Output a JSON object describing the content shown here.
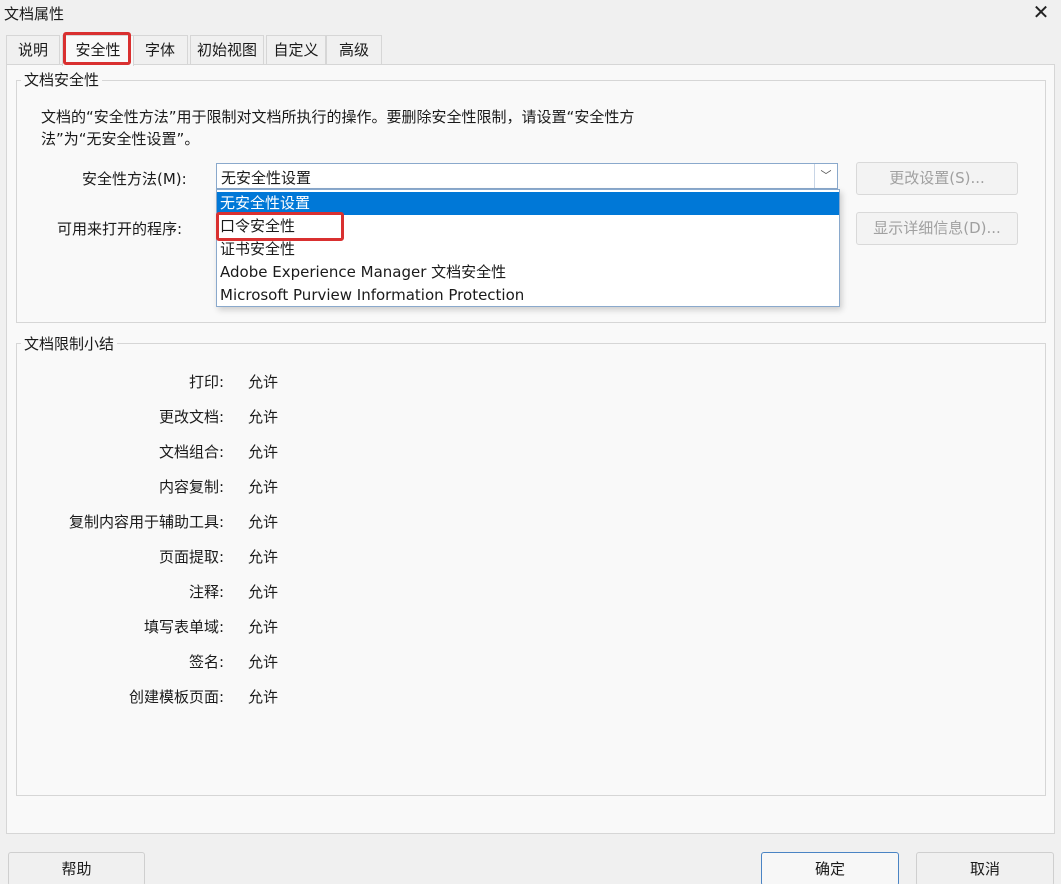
{
  "window": {
    "title": "文档属性",
    "close_icon": "close-icon"
  },
  "tabs": [
    {
      "label": "说明"
    },
    {
      "label": "安全性",
      "active": true
    },
    {
      "label": "字体"
    },
    {
      "label": "初始视图"
    },
    {
      "label": "自定义"
    },
    {
      "label": "高级"
    }
  ],
  "security": {
    "group_title": "文档安全性",
    "description_line1": "文档的“安全性方法”用于限制对文档所执行的操作。要删除安全性限制，请设置“安全性方",
    "description_line2": "法”为“无安全性设置”。",
    "method_label": "安全性方法(M):",
    "method_value": "无安全性设置",
    "open_with_label": "可用来打开的程序:",
    "change_settings_button": "更改设置(S)...",
    "show_details_button": "显示详细信息(D)...",
    "dropdown_options": [
      "无安全性设置",
      "口令安全性",
      "证书安全性",
      "Adobe Experience Manager 文档安全性",
      "Microsoft Purview Information Protection"
    ],
    "highlight_color": "#d93030",
    "selected_color": "#0078d7"
  },
  "summary": {
    "group_title": "文档限制小结",
    "rows": [
      {
        "label": "打印:",
        "value": "允许"
      },
      {
        "label": "更改文档:",
        "value": "允许"
      },
      {
        "label": "文档组合:",
        "value": "允许"
      },
      {
        "label": "内容复制:",
        "value": "允许"
      },
      {
        "label": "复制内容用于辅助工具:",
        "value": "允许"
      },
      {
        "label": "页面提取:",
        "value": "允许"
      },
      {
        "label": "注释:",
        "value": "允许"
      },
      {
        "label": "填写表单域:",
        "value": "允许"
      },
      {
        "label": "签名:",
        "value": "允许"
      },
      {
        "label": "创建模板页面:",
        "value": "允许"
      }
    ]
  },
  "footer": {
    "help_button": "帮助",
    "ok_button": "确定",
    "cancel_button": "取消"
  }
}
